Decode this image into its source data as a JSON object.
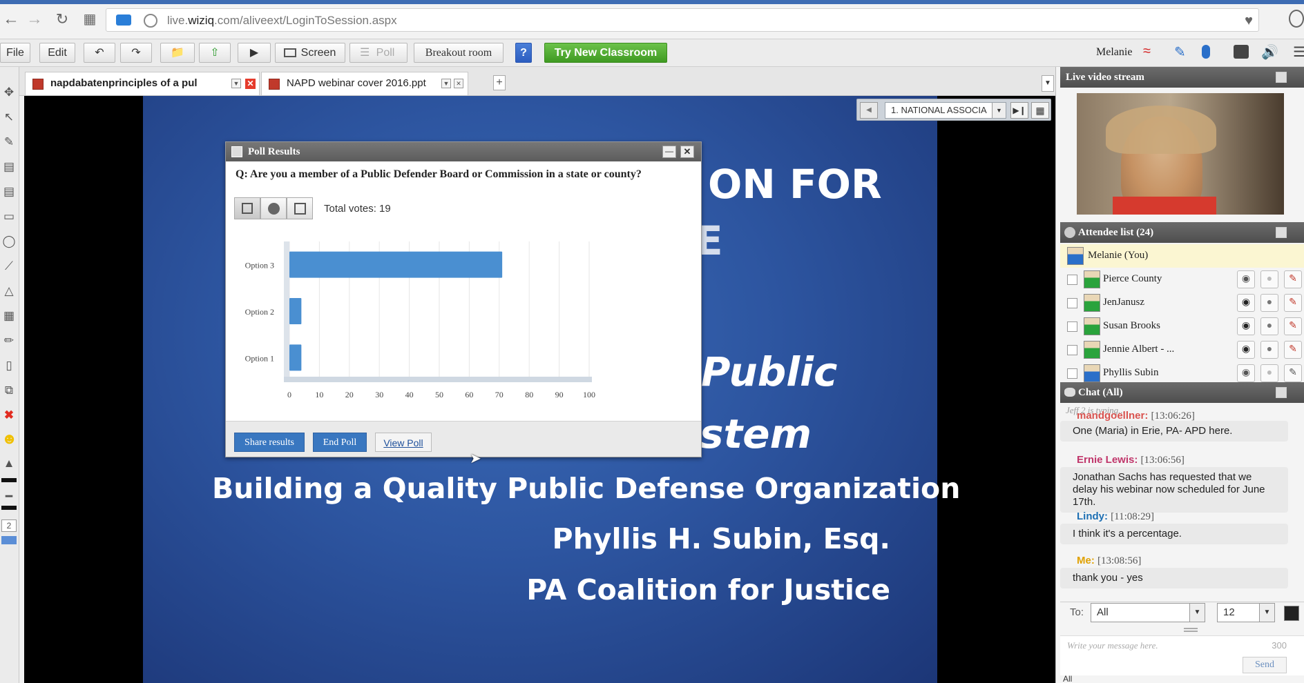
{
  "browser": {
    "url_prefix": "live.",
    "url_domain": "wiziq",
    "url_rest": ".com/aliveext/LoginToSession.aspx"
  },
  "toolbar": {
    "file": "File",
    "edit": "Edit",
    "screen": "Screen",
    "poll": "Poll",
    "breakout": "Breakout room",
    "help": "?",
    "try_new": "Try New Classroom",
    "user_name": "Melanie"
  },
  "left_tools": {
    "page_number": "2"
  },
  "tabs": [
    {
      "label": "napdabatenprinciples of a pul",
      "active": true
    },
    {
      "label": "NAPD webinar cover 2016.ppt",
      "active": false
    }
  ],
  "slide_nav": {
    "current": "1. NATIONAL ASSOCIA"
  },
  "slide": {
    "line1": "ON FOR",
    "line2": "E",
    "line3": "Public",
    "line4": "stem",
    "line5": "Building a Quality Public Defense Organization",
    "line6": "Phyllis H. Subin, Esq.",
    "line7": "PA Coalition for Justice"
  },
  "poll": {
    "title": "Poll Results",
    "question": "Q:  Are you a member of a Public Defender Board or Commission in a state or county?",
    "total_votes": "Total votes: 19",
    "share_label": "Share results",
    "end_label": "End Poll",
    "view_label": "View Poll"
  },
  "chart_data": {
    "type": "bar",
    "orientation": "horizontal",
    "categories": [
      "Option 3",
      "Option 2",
      "Option 1"
    ],
    "values": [
      71,
      4,
      4
    ],
    "xlim": [
      0,
      100
    ],
    "x_ticks": [
      "0",
      "10",
      "20",
      "30",
      "40",
      "50",
      "60",
      "70",
      "80",
      "90",
      "100"
    ],
    "bar_color": "#4a8fd1",
    "grid": true
  },
  "right_panel": {
    "video_title": "Live video stream",
    "attendee_title": "Attendee list (24)",
    "attendees": [
      {
        "name": "Melanie (You)",
        "self": true
      },
      {
        "name": "Pierce County"
      },
      {
        "name": "JenJanusz"
      },
      {
        "name": "Susan Brooks"
      },
      {
        "name": "Jennie Albert - ..."
      },
      {
        "name": "Phyllis Subin"
      }
    ],
    "chat_title": "Chat (All)",
    "typing": "Jeff 2 is typing...",
    "messages": [
      {
        "name": "mandgoellner:",
        "time": "[13:06:26]",
        "text": "One (Maria) in Erie, PA- APD here.",
        "color": "#d9534f"
      },
      {
        "name": "Ernie Lewis:",
        "time": "[13:06:56]",
        "text": "Jonathan Sachs has requested that we delay his webinar now scheduled for June 17th.",
        "color": "#c0356a"
      },
      {
        "name": "Lindy:",
        "time": "[11:08:29]",
        "text": "I think it's a percentage.",
        "color": "#1d6fb3"
      },
      {
        "name": "Me:",
        "time": "[13:08:56]",
        "text": "thank you - yes",
        "color": "#e0a100"
      }
    ],
    "to_label": "To:",
    "to_value": "All",
    "font_size": "12",
    "message_placeholder": "Write your message here.",
    "char_count": "300",
    "send_label": "Send",
    "bottom_select": "All"
  }
}
